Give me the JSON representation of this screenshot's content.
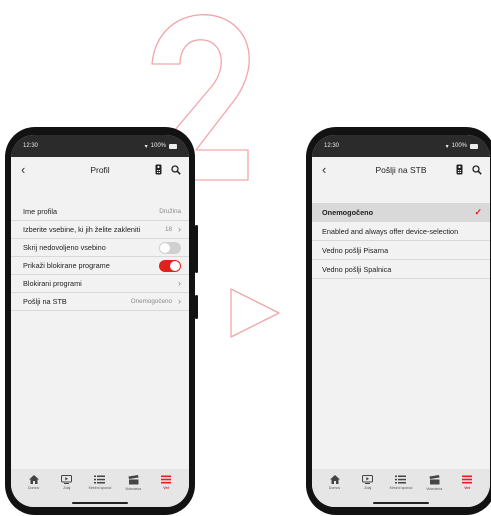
{
  "illustration": {
    "step_number_icon": "outlined-number-two",
    "arrow_icon": "outlined-arrow-right"
  },
  "colors": {
    "accent": "#e3211b",
    "outline_pink": "#f1a6a8"
  },
  "left_phone": {
    "status_time": "12:30",
    "status_battery": "100%",
    "title": "Profil",
    "rows": [
      {
        "label": "Ime profila",
        "value": "Družina"
      },
      {
        "label": "Izberite vsebine, ki jih želite zakleniti",
        "value": "18"
      },
      {
        "label": "Skrij nedovoljeno vsebino",
        "toggle_on": false
      },
      {
        "label": "Prikaži blokirane programe",
        "toggle_on": true
      },
      {
        "label": "Blokirani programi",
        "value": ""
      },
      {
        "label": "Pošlji na  STB",
        "value": "Onemogočeno"
      }
    ]
  },
  "right_phone": {
    "status_time": "12:30",
    "status_battery": "100%",
    "title": "Pošlji na  STB",
    "options": [
      {
        "label": "Onemogočeno",
        "selected": true
      },
      {
        "label": "Enabled and always offer device-selection",
        "selected": false
      },
      {
        "label": "Vedno pošlji Pisarna",
        "selected": false
      },
      {
        "label": "Vedno pošlji Spalnica",
        "selected": false
      }
    ]
  },
  "tabs": [
    {
      "label": "Domov",
      "icon": "home-icon"
    },
    {
      "label": "Zdaj",
      "icon": "tv-play-icon"
    },
    {
      "label": "Mrežni sporod",
      "icon": "list-icon"
    },
    {
      "label": "Videoteka",
      "icon": "clapperboard-icon"
    },
    {
      "label": "Več",
      "icon": "menu-icon"
    }
  ]
}
